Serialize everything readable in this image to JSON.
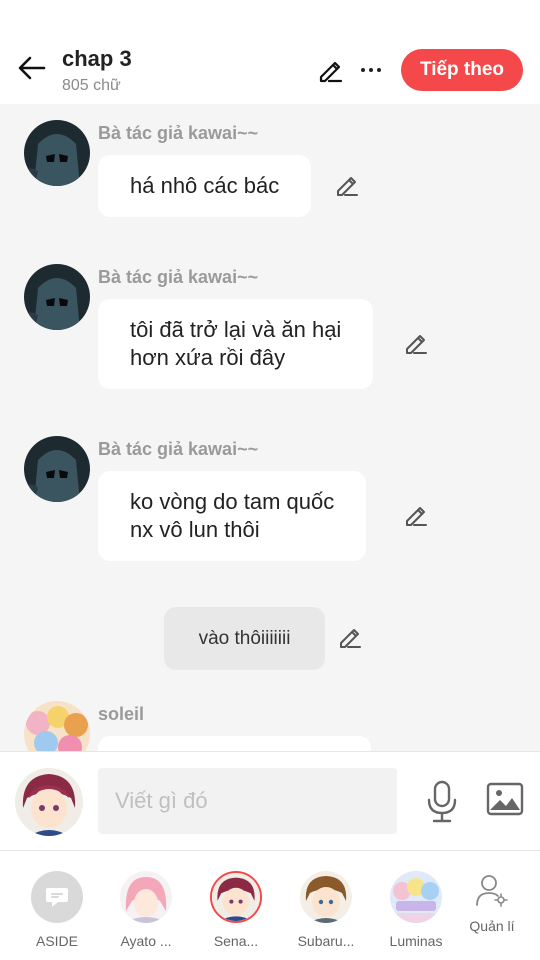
{
  "header": {
    "title": "chap 3",
    "word_count": "805 chữ",
    "next_label": "Tiếp theo"
  },
  "messages": [
    {
      "author": "Bà tác giả kawai~~",
      "line1": "há nhô các bác",
      "line2": ""
    },
    {
      "author": "Bà tác giả kawai~~",
      "line1": "tôi đã trở lại và ăn hại",
      "line2": "hơn xứa rồi đây"
    },
    {
      "author": "Bà tác giả kawai~~",
      "line1": "ko vòng do tam quốc",
      "line2": "nx vô lun thôi"
    },
    {
      "narration": "vào thôiiiiiii"
    },
    {
      "author": "soleil"
    }
  ],
  "composer": {
    "placeholder": "Viết gì đó"
  },
  "characters": [
    {
      "label": "ASIDE"
    },
    {
      "label": "Ayato ..."
    },
    {
      "label": "Sena..."
    },
    {
      "label": "Subaru..."
    },
    {
      "label": "Luminas"
    },
    {
      "label": "Quản lí"
    }
  ],
  "colors": {
    "accent": "#f4484a",
    "background": "#f5f5f5",
    "author_gray": "#9a9a9a"
  }
}
